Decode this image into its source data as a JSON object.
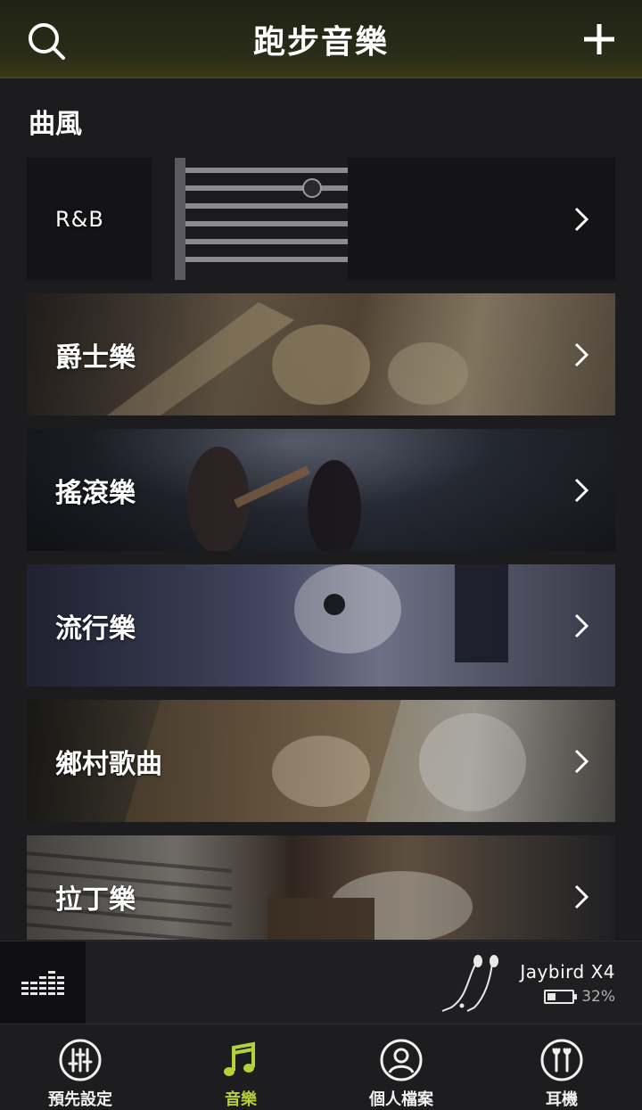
{
  "header": {
    "title": "跑步音樂"
  },
  "section": {
    "title": "曲風"
  },
  "genres": [
    {
      "label": "R&B"
    },
    {
      "label": "爵士樂"
    },
    {
      "label": "搖滾樂"
    },
    {
      "label": "流行樂"
    },
    {
      "label": "鄉村歌曲"
    },
    {
      "label": "拉丁樂"
    }
  ],
  "player": {
    "device_name": "Jaybird X4",
    "battery_text": "32%",
    "battery_level": 0.32
  },
  "tabs": [
    {
      "label": "預先設定",
      "icon": "sliders-icon"
    },
    {
      "label": "音樂",
      "icon": "music-note-icon",
      "active": true
    },
    {
      "label": "個人檔案",
      "icon": "profile-icon"
    },
    {
      "label": "耳機",
      "icon": "earbuds-icon"
    }
  ],
  "colors": {
    "accent": "#b5d334",
    "background": "#1c1c1e"
  }
}
